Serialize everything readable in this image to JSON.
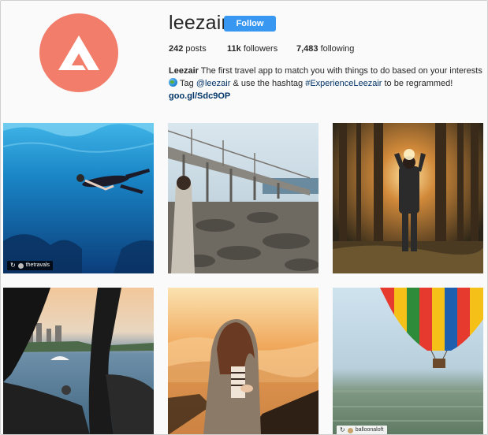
{
  "profile": {
    "username": "leezair",
    "follow_label": "Follow",
    "avatar_icon": "leezair-logo-icon",
    "brand_color": "#f27d6a",
    "accent_color": "#3897f0"
  },
  "stats": {
    "posts_count": "242",
    "posts_label": "posts",
    "followers_count": "11k",
    "followers_label": "followers",
    "following_count": "7,483",
    "following_label": "following"
  },
  "bio": {
    "name": "Leezair",
    "description": "The first travel app to match you with things to do based on your interests",
    "line2_prefix": "Tag",
    "mention": "@leezair",
    "line2_middle": "& use the hashtag",
    "hashtag": "#ExperienceLeezair",
    "line2_suffix": "to be regrammed!",
    "url": "goo.gl/Sdc9OP",
    "globe_icon": "globe-emoji-icon"
  },
  "posts": [
    {
      "subject": "underwater-swimmer",
      "repost_user": "thetravals"
    },
    {
      "subject": "woman-on-pier"
    },
    {
      "subject": "man-in-forest-sunset"
    },
    {
      "subject": "helicopter-over-sydney"
    },
    {
      "subject": "woman-above-clouds"
    },
    {
      "subject": "hot-air-balloon",
      "repost_user": "balloonaloft"
    }
  ]
}
